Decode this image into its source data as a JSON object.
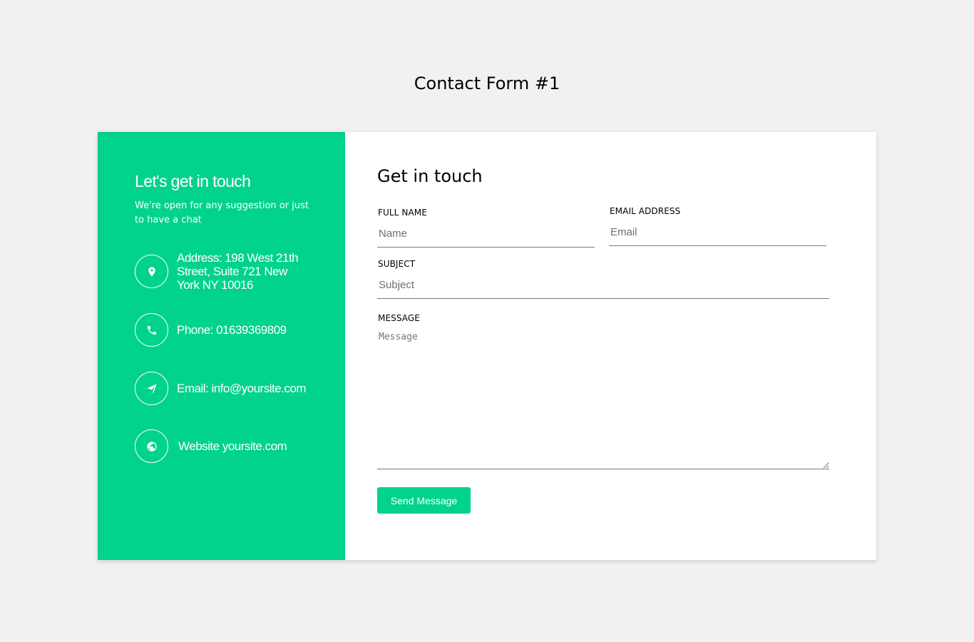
{
  "page": {
    "title": "Contact Form #1"
  },
  "colors": {
    "accent": "#01d28e",
    "background": "#f2f0f1",
    "card": "#ffffff"
  },
  "info": {
    "heading": "Let's get in touch",
    "subtitle": "We're open for any suggestion or just to have a chat",
    "items": [
      {
        "icon": "map-pin-icon",
        "text": "Address: 198 West 21th Street, Suite 721 New York NY 10016"
      },
      {
        "icon": "phone-icon",
        "text": "Phone: 01639369809"
      },
      {
        "icon": "paper-plane-icon",
        "text": "Email: info@yoursite.com"
      },
      {
        "icon": "globe-icon",
        "text": "Website yoursite.com"
      }
    ]
  },
  "form": {
    "heading": "Get in touch",
    "full_name": {
      "label": "FULL NAME",
      "placeholder": "Name",
      "value": ""
    },
    "email": {
      "label": "EMAIL ADDRESS",
      "placeholder": "Email",
      "value": ""
    },
    "subject": {
      "label": "SUBJECT",
      "placeholder": "Subject",
      "value": ""
    },
    "message": {
      "label": "MESSAGE",
      "placeholder": "Message",
      "value": ""
    },
    "submit_label": "Send Message"
  }
}
